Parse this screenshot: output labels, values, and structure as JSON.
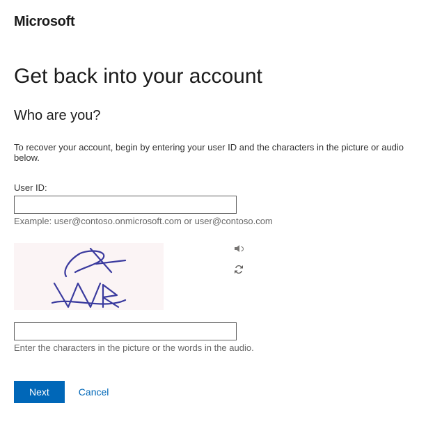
{
  "brand": "Microsoft",
  "page_title": "Get back into your account",
  "subtitle": "Who are you?",
  "instructions": "To recover your account, begin by entering your user ID and the characters in the picture or audio below.",
  "user_id": {
    "label": "User ID:",
    "value": "",
    "hint": "Example: user@contoso.onmicrosoft.com or user@contoso.com"
  },
  "captcha": {
    "image_text": "S4 WK",
    "input_value": "",
    "input_hint": "Enter the characters in the picture or the words in the audio.",
    "audio_icon": "speaker-icon",
    "refresh_icon": "refresh-icon"
  },
  "actions": {
    "next_label": "Next",
    "cancel_label": "Cancel"
  },
  "colors": {
    "primary": "#0067b8",
    "text": "#333333",
    "muted": "#666666",
    "captcha_bg": "#fbf4f5"
  }
}
